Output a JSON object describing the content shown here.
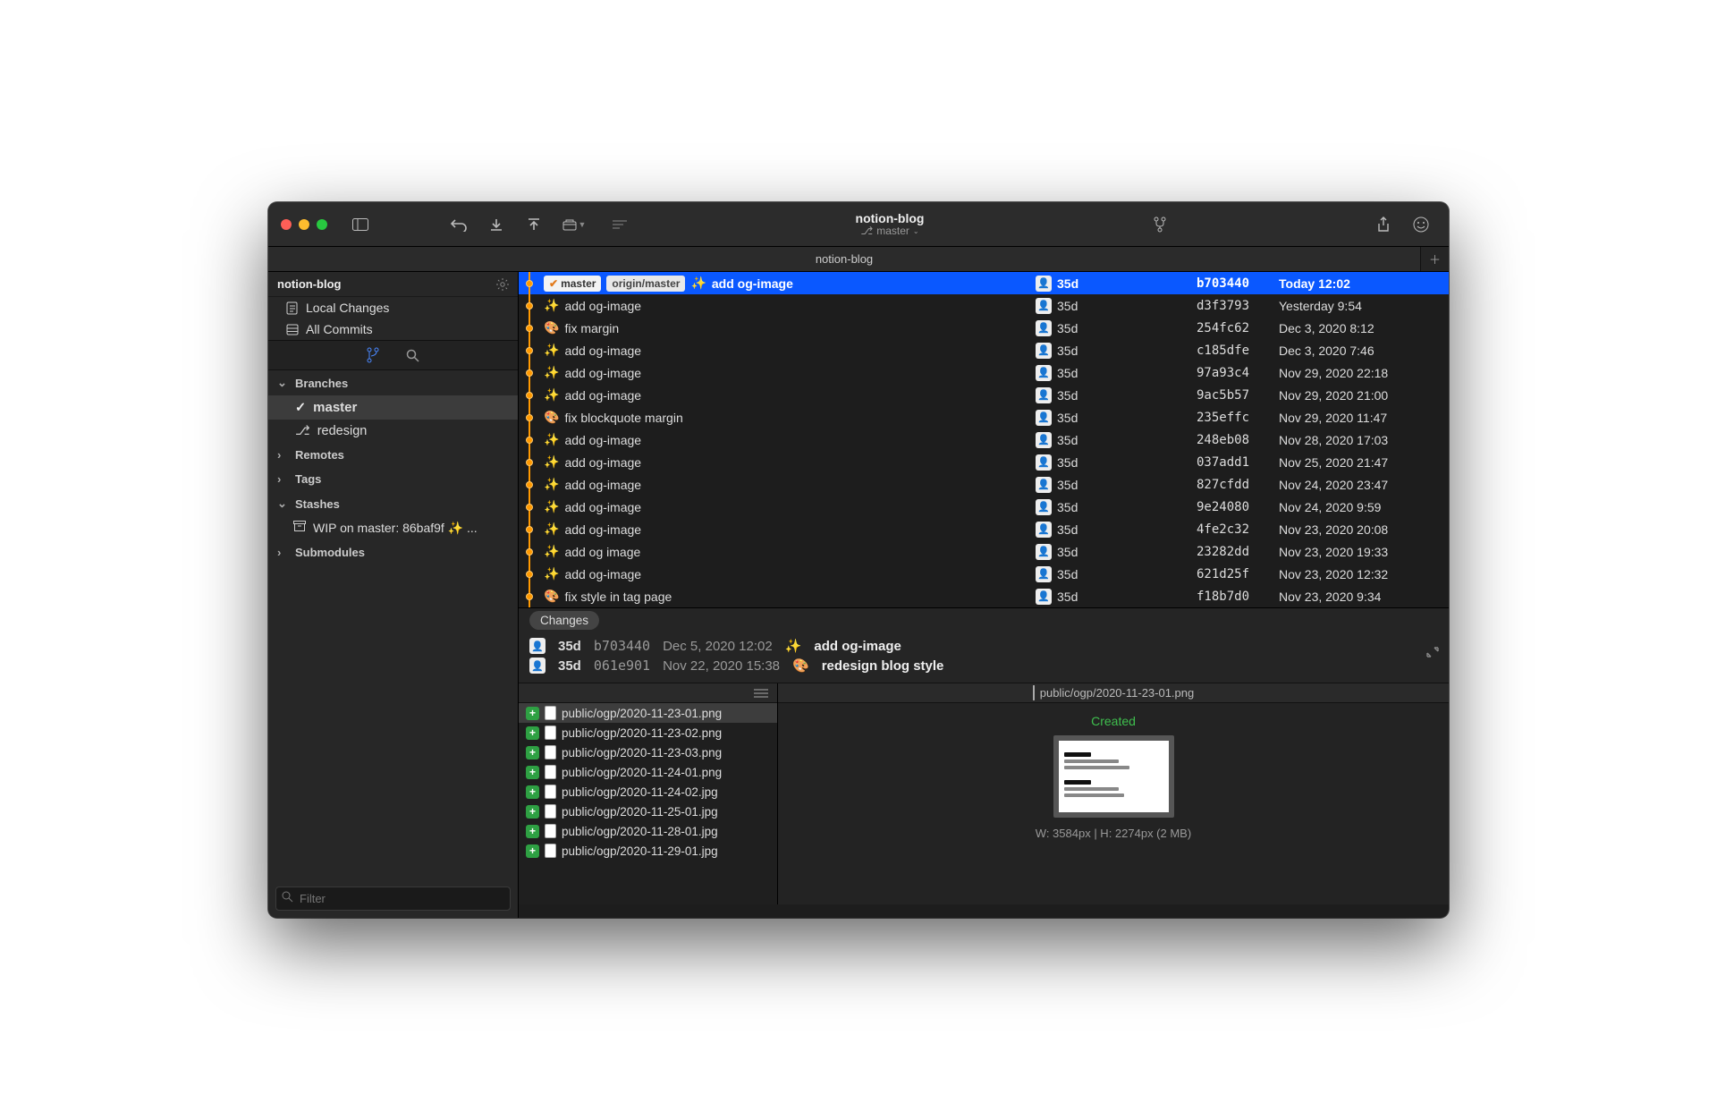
{
  "titlebar": {
    "title": "notion-blog",
    "branch_icon": "⎇",
    "branch_label": "master"
  },
  "tabbar": {
    "tab": "notion-blog"
  },
  "sidebar": {
    "repo": "notion-blog",
    "local_changes": "Local Changes",
    "all_commits": "All Commits",
    "branches_header": "Branches",
    "branch_master": "master",
    "branch_redesign": "redesign",
    "remotes_header": "Remotes",
    "tags_header": "Tags",
    "stashes_header": "Stashes",
    "stash_item": "WIP on master: 86baf9f ✨ ...",
    "submodules_header": "Submodules",
    "filter_placeholder": "Filter"
  },
  "commits": [
    {
      "emoji": "✨",
      "msg": "add og-image",
      "badge_local": "master",
      "badge_remote": "origin/master",
      "author": "35d",
      "hash": "b703440",
      "date": "Today 12:02",
      "selected": true
    },
    {
      "emoji": "✨",
      "msg": "add og-image",
      "author": "35d",
      "hash": "d3f3793",
      "date": "Yesterday 9:54"
    },
    {
      "emoji": "🎨",
      "msg": "fix margin",
      "author": "35d",
      "hash": "254fc62",
      "date": "Dec 3, 2020 8:12"
    },
    {
      "emoji": "✨",
      "msg": "add og-image",
      "author": "35d",
      "hash": "c185dfe",
      "date": "Dec 3, 2020 7:46"
    },
    {
      "emoji": "✨",
      "msg": "add og-image",
      "author": "35d",
      "hash": "97a93c4",
      "date": "Nov 29, 2020 22:18"
    },
    {
      "emoji": "✨",
      "msg": "add og-image",
      "author": "35d",
      "hash": "9ac5b57",
      "date": "Nov 29, 2020 21:00"
    },
    {
      "emoji": "🎨",
      "msg": "fix blockquote margin",
      "author": "35d",
      "hash": "235effc",
      "date": "Nov 29, 2020 11:47"
    },
    {
      "emoji": "✨",
      "msg": "add og-image",
      "author": "35d",
      "hash": "248eb08",
      "date": "Nov 28, 2020 17:03"
    },
    {
      "emoji": "✨",
      "msg": "add og-image",
      "author": "35d",
      "hash": "037add1",
      "date": "Nov 25, 2020 21:47"
    },
    {
      "emoji": "✨",
      "msg": "add og-image",
      "author": "35d",
      "hash": "827cfdd",
      "date": "Nov 24, 2020 23:47"
    },
    {
      "emoji": "✨",
      "msg": "add og-image",
      "author": "35d",
      "hash": "9e24080",
      "date": "Nov 24, 2020 9:59"
    },
    {
      "emoji": "✨",
      "msg": "add og-image",
      "author": "35d",
      "hash": "4fe2c32",
      "date": "Nov 23, 2020 20:08"
    },
    {
      "emoji": "✨",
      "msg": "add og image",
      "author": "35d",
      "hash": "23282dd",
      "date": "Nov 23, 2020 19:33"
    },
    {
      "emoji": "✨",
      "msg": "add og-image",
      "author": "35d",
      "hash": "621d25f",
      "date": "Nov 23, 2020 12:32"
    },
    {
      "emoji": "🎨",
      "msg": "fix style in tag page",
      "author": "35d",
      "hash": "f18b7d0",
      "date": "Nov 23, 2020 9:34"
    }
  ],
  "detail": {
    "tab_label": "Changes",
    "rows": [
      {
        "author": "35d",
        "hash": "b703440",
        "date": "Dec 5, 2020 12:02",
        "emoji": "✨",
        "msg": "add og-image"
      },
      {
        "author": "35d",
        "hash": "061e901",
        "date": "Nov 22, 2020 15:38",
        "emoji": "🎨",
        "msg": "redesign blog style"
      }
    ],
    "files": [
      "public/ogp/2020-11-23-01.png",
      "public/ogp/2020-11-23-02.png",
      "public/ogp/2020-11-23-03.png",
      "public/ogp/2020-11-24-01.png",
      "public/ogp/2020-11-24-02.jpg",
      "public/ogp/2020-11-25-01.jpg",
      "public/ogp/2020-11-28-01.jpg",
      "public/ogp/2020-11-29-01.jpg"
    ],
    "preview_path": "public/ogp/2020-11-23-01.png",
    "created_label": "Created",
    "image_info": "W: 3584px | H: 2274px (2 MB)"
  }
}
